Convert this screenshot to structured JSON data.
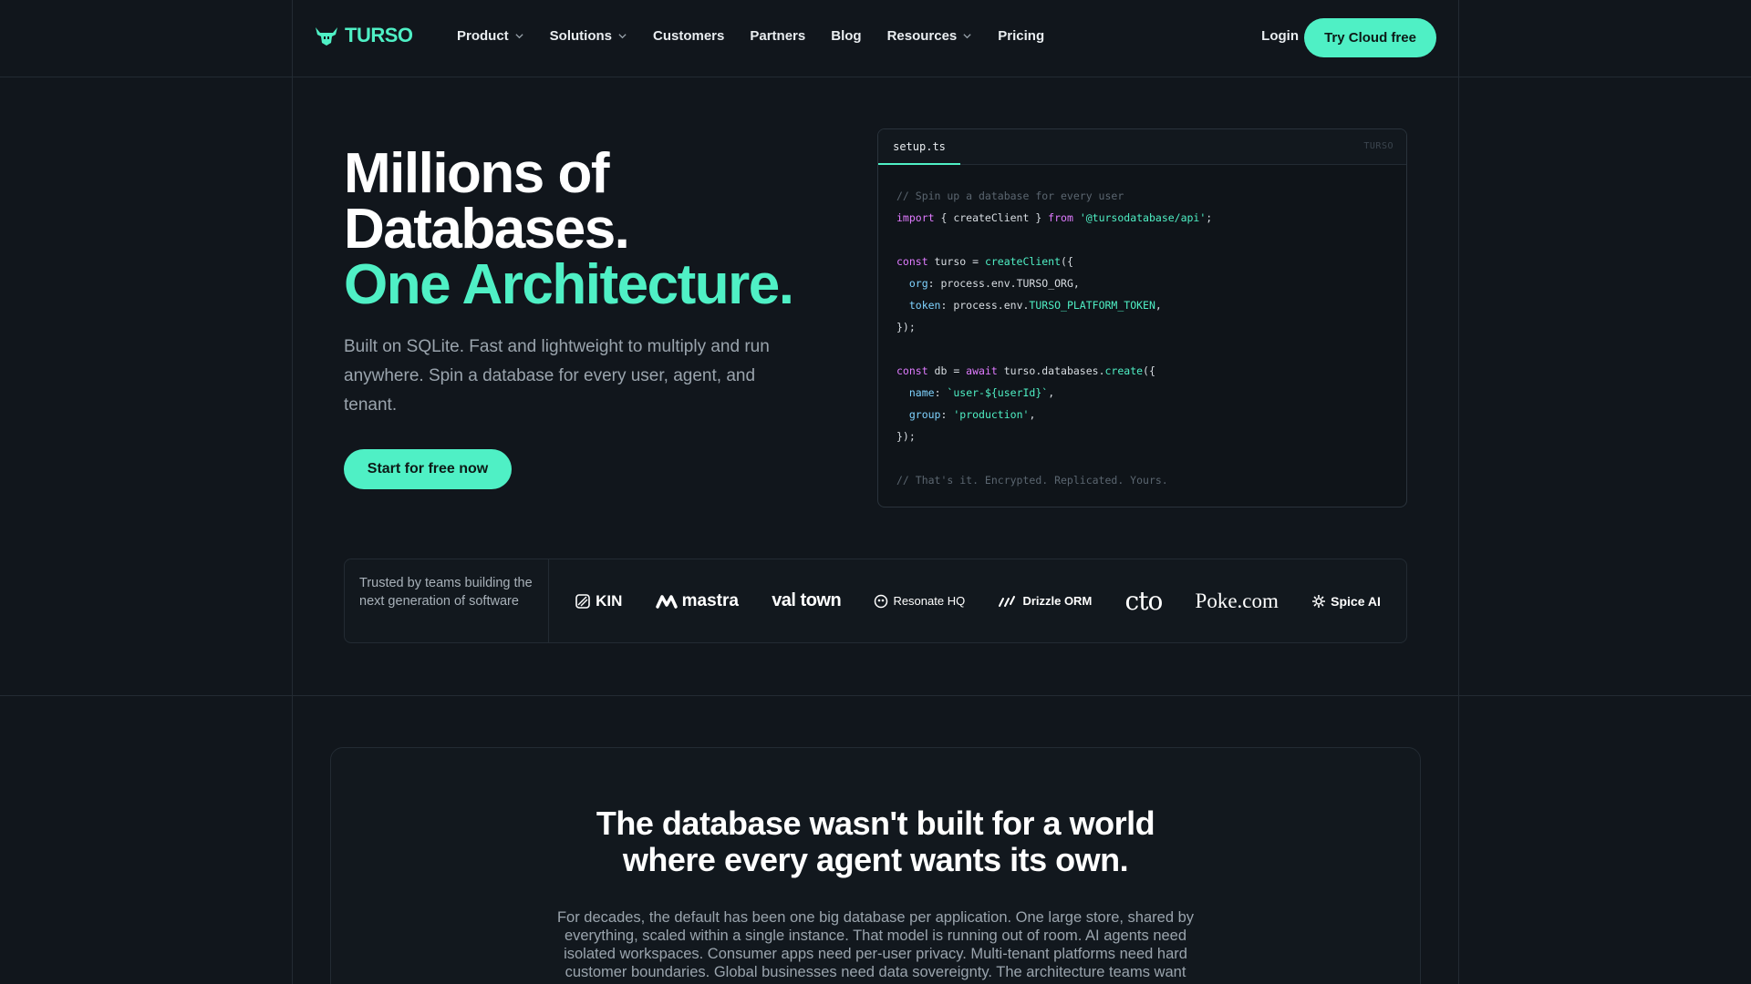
{
  "nav": {
    "logo_text": "TURSO",
    "links": [
      {
        "label": "Product",
        "dropdown": true
      },
      {
        "label": "Solutions",
        "dropdown": true
      },
      {
        "label": "Customers",
        "dropdown": false
      },
      {
        "label": "Partners",
        "dropdown": false
      },
      {
        "label": "Blog",
        "dropdown": false
      },
      {
        "label": "Resources",
        "dropdown": true
      },
      {
        "label": "Pricing",
        "dropdown": false
      }
    ],
    "login_label": "Login",
    "cta_label": "Try Cloud free"
  },
  "hero": {
    "title_line1": "Millions of",
    "title_line2": "Databases.",
    "title_line3": "One Architecture.",
    "subtitle": "Built on SQLite. Fast and lightweight to multiply and run anywhere. Spin a database for every user, agent, and tenant.",
    "cta_label": "Start for free now"
  },
  "code": {
    "tab": "setup.ts",
    "brand": "TURSO",
    "comment1": "// Spin up a database for every user",
    "import_kw": "import",
    "import_mid": " { createClient } ",
    "from_kw": "from",
    "import_path": "'@tursodatabase/api'",
    "const1": "const",
    "turso_var": " turso = ",
    "create_fn": "createClient",
    "paren_open": "({",
    "org_key": "org",
    "org_val": ": process.env.TURSO_ORG,",
    "token_key": "token",
    "token_pre": ": process.env.",
    "token_env": "TURSO_PLATFORM_TOKEN",
    "comma": ",",
    "close1": "});",
    "const2": "const",
    "db_var": " db = ",
    "await_kw": "await",
    "db_call_pre": " turso.databases.",
    "db_fn": "create",
    "paren_open2": "({",
    "name_key": "name",
    "colon1": ": ",
    "name_val": "`user-${userId}`",
    "comma2": ",",
    "group_key": "group",
    "colon2": ": ",
    "group_val": "'production'",
    "comma3": ",",
    "close2": "});",
    "comment2": "// That's it. Encrypted. Replicated. Yours."
  },
  "trust": {
    "text": "Trusted by teams building the next generation of software",
    "logos": [
      "KIN",
      "mastra",
      "val town",
      "Resonate HQ",
      "Drizzle ORM",
      "cto",
      "Poke.com",
      "Spice AI"
    ]
  },
  "section": {
    "title_line1": "The database wasn't built for a world",
    "title_line2": "where every agent wants its own.",
    "body": "For decades, the default has been one big database per application. One large store, shared by everything, scaled within a single instance. That model is running out of room. AI agents need isolated workspaces. Consumer apps need per-user privacy. Multi-tenant platforms need hard customer boundaries. Global businesses need data sovereignty. The architecture teams want"
  },
  "colors": {
    "background": "#11161c",
    "accent": "#4ff0c5",
    "muted_text": "#9aa4ad",
    "keyword": "#e07bff"
  }
}
